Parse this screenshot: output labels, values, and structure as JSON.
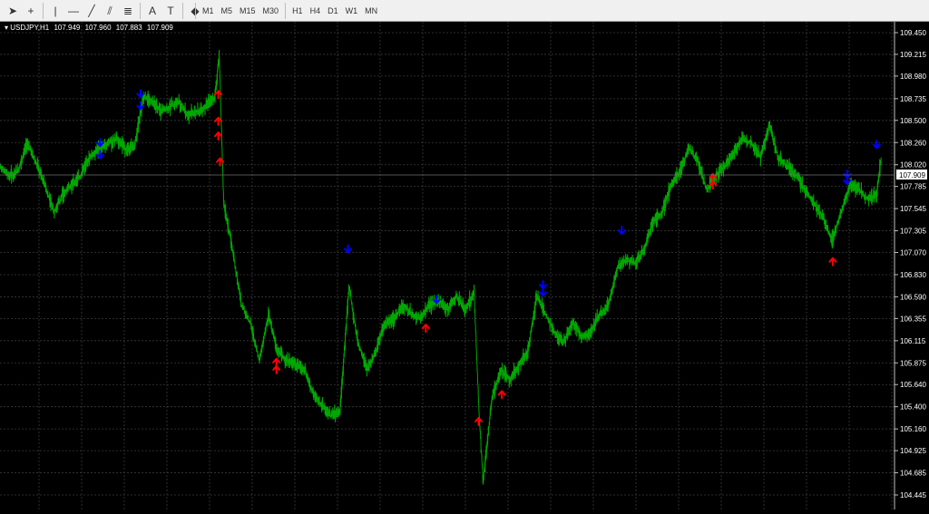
{
  "toolbar": {
    "tools": [
      {
        "name": "cursor-icon",
        "glyph": "➤"
      },
      {
        "name": "crosshair-icon",
        "glyph": "+"
      },
      {
        "name": "vertical-line-icon",
        "glyph": "|"
      },
      {
        "name": "horizontal-line-icon",
        "glyph": "—"
      },
      {
        "name": "trend-line-icon",
        "glyph": "╱"
      },
      {
        "name": "equidistant-channel-icon",
        "glyph": "⫽"
      },
      {
        "name": "fibonacci-icon",
        "glyph": "≣"
      },
      {
        "name": "text-icon",
        "glyph": "A"
      },
      {
        "name": "text-label-icon",
        "glyph": "T"
      },
      {
        "name": "shapes-icon",
        "glyph": "◆"
      }
    ],
    "timeframes": [
      "M1",
      "M5",
      "M15",
      "M30",
      "H1",
      "H4",
      "D1",
      "W1",
      "MN"
    ]
  },
  "header": {
    "symbol": "USDJPY,H1",
    "open": "107.949",
    "high": "107.960",
    "low": "107.883",
    "close": "107.909"
  },
  "colors": {
    "background": "#000000",
    "grid": "#3a3a3a",
    "candles": "#00a800",
    "arrow_up": "#ff0000",
    "arrow_down": "#0000ff",
    "price_tag_bg": "#ffffff"
  },
  "chart_data": {
    "type": "line",
    "symbol": "USDJPY",
    "timeframe": "H1",
    "y_ticks": [
      "109.450",
      "109.215",
      "108.980",
      "108.735",
      "108.500",
      "108.260",
      "108.020",
      "107.785",
      "107.545",
      "107.305",
      "107.070",
      "106.830",
      "106.590",
      "106.355",
      "106.115",
      "105.875",
      "105.640",
      "105.400",
      "105.160",
      "104.925",
      "104.685",
      "104.445"
    ],
    "ylim": [
      104.445,
      109.45
    ],
    "current_price": "107.909",
    "x_index_range": [
      0,
      1000
    ],
    "series": [
      {
        "x": [
          0,
          10,
          20,
          30,
          40,
          50,
          60,
          70,
          80,
          90,
          100,
          110,
          120,
          130,
          140,
          150,
          160,
          170,
          180,
          190,
          200,
          210,
          220,
          230,
          240,
          245,
          250,
          260,
          270,
          280,
          290,
          300,
          310,
          320,
          330,
          340,
          350,
          360,
          370,
          380,
          390,
          400,
          410,
          420,
          430,
          440,
          450,
          460,
          470,
          480,
          490,
          500,
          510,
          520,
          530,
          535,
          540,
          550,
          560,
          570,
          580,
          590,
          600,
          610,
          620,
          630,
          640,
          650,
          660,
          670,
          680,
          690,
          700,
          710,
          720,
          730,
          740,
          750,
          760,
          770,
          780,
          790,
          800,
          810,
          820,
          830,
          840,
          850,
          860,
          870,
          880,
          890,
          900,
          910,
          920,
          930,
          940,
          950,
          960,
          970,
          980,
          985
        ],
        "y": [
          108.0,
          107.9,
          107.95,
          108.25,
          108.05,
          107.8,
          107.5,
          107.7,
          107.8,
          107.9,
          108.1,
          108.2,
          108.25,
          108.3,
          108.2,
          108.2,
          108.75,
          108.7,
          108.6,
          108.65,
          108.7,
          108.55,
          108.6,
          108.65,
          108.75,
          109.2,
          107.6,
          107.1,
          106.5,
          106.3,
          105.9,
          106.4,
          106.0,
          105.9,
          105.85,
          105.8,
          105.55,
          105.4,
          105.3,
          105.35,
          106.7,
          106.1,
          105.8,
          106.0,
          106.3,
          106.35,
          106.5,
          106.4,
          106.35,
          106.5,
          106.55,
          106.45,
          106.6,
          106.45,
          106.65,
          105.4,
          104.6,
          105.5,
          105.8,
          105.7,
          105.85,
          106.0,
          106.6,
          106.4,
          106.2,
          106.1,
          106.3,
          106.15,
          106.2,
          106.4,
          106.5,
          106.9,
          107.0,
          106.95,
          107.1,
          107.4,
          107.5,
          107.8,
          107.95,
          108.2,
          108.05,
          107.75,
          107.9,
          108.0,
          108.15,
          108.3,
          108.25,
          108.1,
          108.45,
          108.1,
          108.0,
          107.9,
          107.75,
          107.6,
          107.45,
          107.2,
          107.5,
          107.8,
          107.75,
          107.65,
          107.7,
          108.1
        ]
      }
    ],
    "signals": [
      {
        "x": 112,
        "y": 108.26,
        "dir": "down"
      },
      {
        "x": 112,
        "y": 108.13,
        "dir": "down"
      },
      {
        "x": 157,
        "y": 108.79,
        "dir": "down"
      },
      {
        "x": 157,
        "y": 108.66,
        "dir": "down"
      },
      {
        "x": 244,
        "y": 108.78,
        "dir": "up"
      },
      {
        "x": 244,
        "y": 108.49,
        "dir": "up"
      },
      {
        "x": 244,
        "y": 108.33,
        "dir": "up"
      },
      {
        "x": 246,
        "y": 108.05,
        "dir": "up"
      },
      {
        "x": 309,
        "y": 105.88,
        "dir": "up"
      },
      {
        "x": 309,
        "y": 105.8,
        "dir": "up"
      },
      {
        "x": 389,
        "y": 107.11,
        "dir": "down"
      },
      {
        "x": 476,
        "y": 106.25,
        "dir": "up"
      },
      {
        "x": 488,
        "y": 106.56,
        "dir": "down"
      },
      {
        "x": 535,
        "y": 105.24,
        "dir": "up"
      },
      {
        "x": 561,
        "y": 105.53,
        "dir": "up"
      },
      {
        "x": 607,
        "y": 106.72,
        "dir": "down"
      },
      {
        "x": 607,
        "y": 106.64,
        "dir": "down"
      },
      {
        "x": 695,
        "y": 107.31,
        "dir": "down"
      },
      {
        "x": 797,
        "y": 107.88,
        "dir": "up"
      },
      {
        "x": 797,
        "y": 107.8,
        "dir": "up"
      },
      {
        "x": 931,
        "y": 106.97,
        "dir": "up"
      },
      {
        "x": 947,
        "y": 107.92,
        "dir": "down"
      },
      {
        "x": 947,
        "y": 107.85,
        "dir": "down"
      },
      {
        "x": 980,
        "y": 108.24,
        "dir": "down"
      }
    ]
  }
}
